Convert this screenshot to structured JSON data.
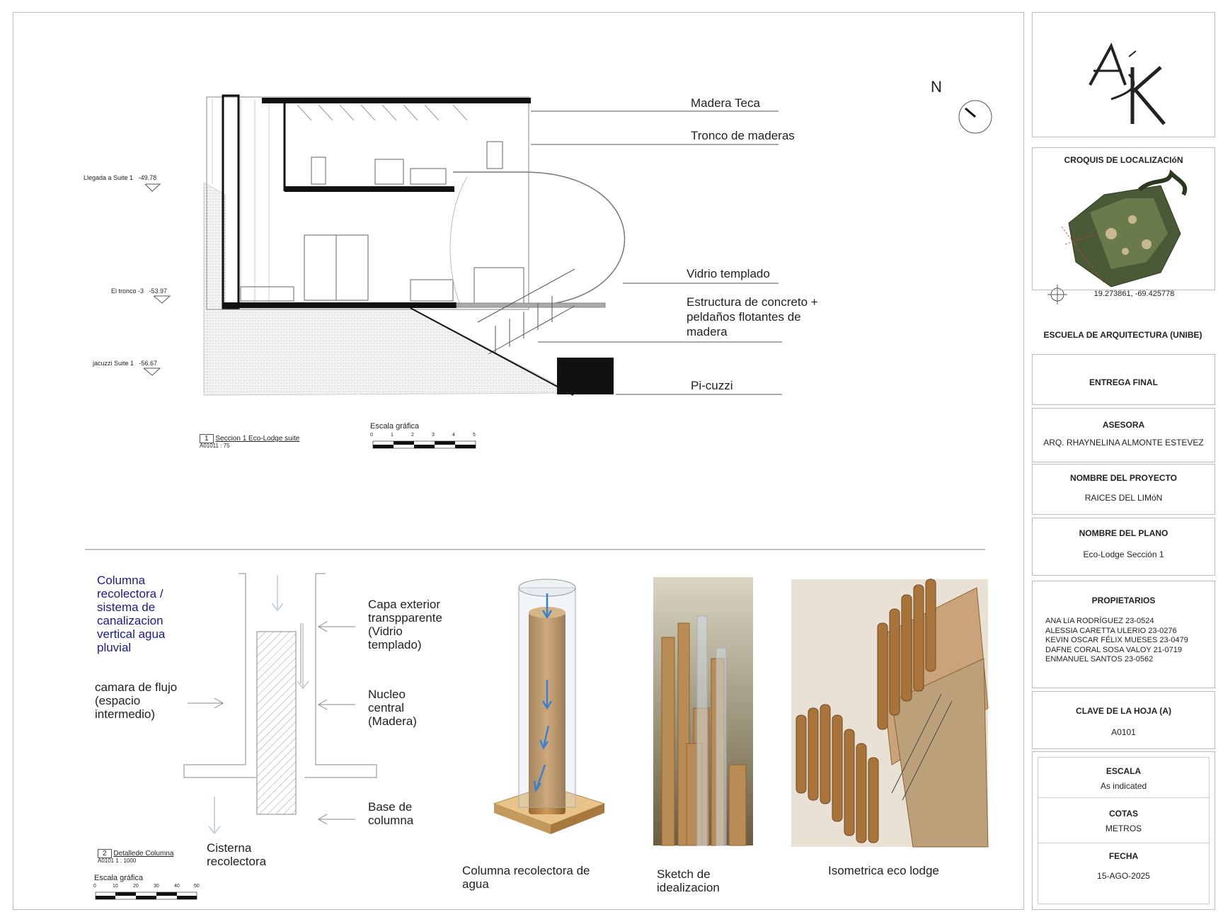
{
  "section": {
    "levels": [
      {
        "name": "Llegada a Suite 1",
        "value": "-49.78"
      },
      {
        "name": "El tronco -3",
        "value": "-53.97"
      },
      {
        "name": "jacuzzi Suite 1",
        "value": "-56.67"
      }
    ],
    "callouts": {
      "madera_teca": "Madera Teca",
      "tronco": "Tronco de maderas",
      "vidrio": "Vidrio templado",
      "estructura": "Estructura de concreto +\npeldaños flotantes de\nmadera",
      "picuzzi": "Pi-cuzzi"
    },
    "north": "N",
    "view_title": {
      "number": "1",
      "name": "Seccion 1 Eco-Lodge suite",
      "ref": "A01011 : 75"
    },
    "scale_bar": {
      "title": "Escala gráfica",
      "ticks": [
        "0",
        "1",
        "2",
        "3",
        "4",
        "5"
      ]
    }
  },
  "detail": {
    "title_blue": "Columna\nrecolectora /\nsistema de\ncanalizacion\nvertical agua\npluvial",
    "camara": "camara de flujo\n(espacio\nintermedio)",
    "cisterna": "Cisterna\nrecolectora",
    "capa": "Capa exterior\ntranspparente\n(Vidrio\ntemplado)",
    "nucleo": "Nucleo\ncentral\n(Madera)",
    "base": "Base de\ncolumna",
    "view_title": {
      "number": "2",
      "name": "Detallede Columna",
      "ref": "A0101 1 : 1000"
    },
    "scale_bar": {
      "title": "Escala gráfica",
      "ticks": [
        "0",
        "10",
        "20",
        "30",
        "40",
        "50"
      ]
    },
    "captions": {
      "columna": "Columna recolectora de\nagua",
      "sketch": "Sketch de\nidealizacion",
      "isometrica": "Isometrica eco lodge"
    }
  },
  "title_block": {
    "croquis_title": "CROQUIS DE LOCALIZACIóN",
    "coords": "19.273861, -69.425778",
    "school": "ESCUELA DE ARQUITECTURA (UNIBE)",
    "entrega": "ENTREGA FINAL",
    "asesora_head": "ASESORA",
    "asesora": "ARQ. RHAYNELINA ALMONTE ESTEVEZ",
    "proyecto_head": "NOMBRE DEL PROYECTO",
    "proyecto": "RAICES DEL LIMóN",
    "plano_head": "NOMBRE DEL PLANO",
    "plano": "Eco-Lodge Sección 1",
    "propietarios_head": "PROPIETARIOS",
    "propietarios": [
      "ANA LíA RODRÍGUEZ 23-0524",
      "ALESSIA CARETTA ULERIO 23-0276",
      "KEVIN OSCAR FÉLIX MUESES 23-0479",
      "DAFNE CORAL SOSA VALOY 21-0719",
      "ENMANUEL SANTOS 23-0562"
    ],
    "clave_head": "CLAVE DE LA HOJA (A)",
    "clave": "A0101",
    "escala_head": "ESCALA",
    "escala": "As indicated",
    "cotas_head": "COTAS",
    "cotas": "METROS",
    "fecha_head": "FECHA",
    "fecha": "15-AGO-2025"
  },
  "colors": {
    "wood": "#b8894f",
    "blue_text": "#1a1a8c",
    "frame": "#bbbbbb"
  }
}
